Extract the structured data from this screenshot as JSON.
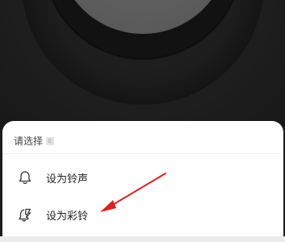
{
  "sheet": {
    "title": "请选择",
    "tag_icon": "E",
    "items": [
      {
        "label": "设为铃声",
        "icon": "bell-icon"
      },
      {
        "label": "设为彩铃",
        "icon": "crbt-bell-icon"
      }
    ]
  },
  "colors": {
    "backdrop": "#1c1c1c",
    "sheet": "#ffffff",
    "annotation_arrow": "#e02020"
  }
}
